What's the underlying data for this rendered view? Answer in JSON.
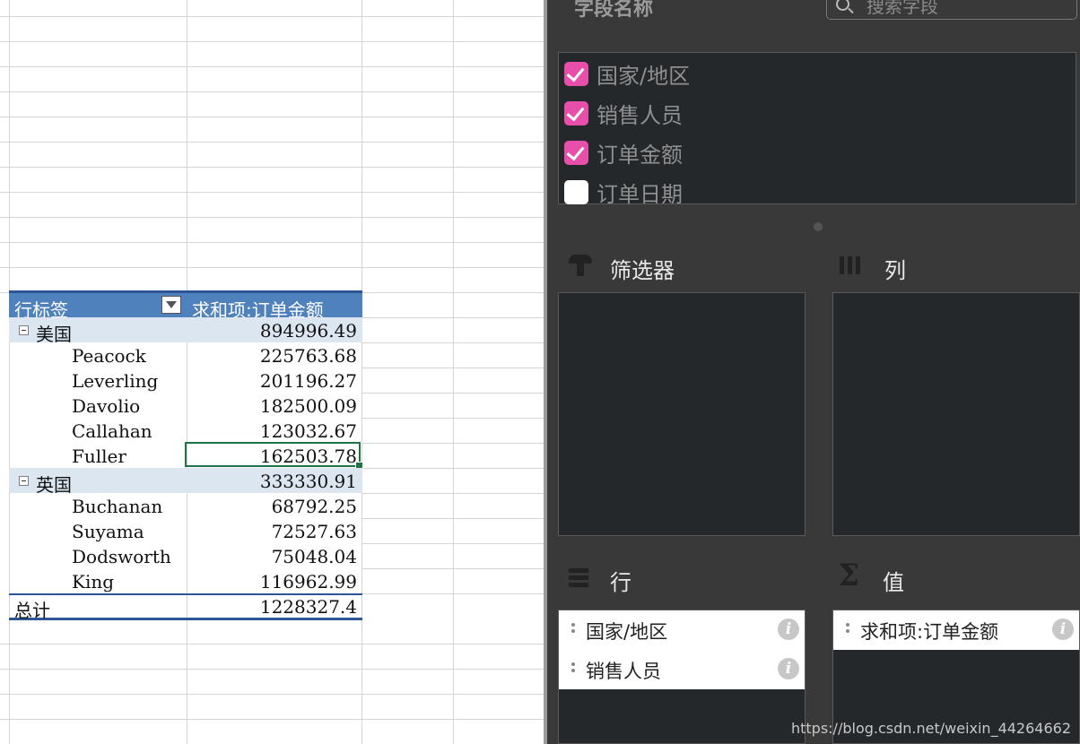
{
  "pivot": {
    "header": {
      "row_label": "行标签",
      "value_label": "求和项:订单金额"
    },
    "groups": [
      {
        "name": "美国",
        "total": "894996.49",
        "people": [
          {
            "name": "Peacock",
            "value": "225763.68"
          },
          {
            "name": "Leverling",
            "value": "201196.27"
          },
          {
            "name": "Davolio",
            "value": "182500.09"
          },
          {
            "name": "Callahan",
            "value": "123032.67"
          },
          {
            "name": "Fuller",
            "value": "162503.78"
          }
        ]
      },
      {
        "name": "英国",
        "total": "333330.91",
        "people": [
          {
            "name": "Buchanan",
            "value": "68792.25"
          },
          {
            "name": "Suyama",
            "value": "72527.63"
          },
          {
            "name": "Dodsworth",
            "value": "75048.04"
          },
          {
            "name": "King",
            "value": "116962.99"
          }
        ]
      }
    ],
    "grand_total": {
      "label": "总计",
      "value": "1228327.4"
    }
  },
  "field_pane": {
    "title": "字段名称",
    "search_placeholder": "搜索字段",
    "fields": [
      {
        "label": "国家/地区",
        "checked": true
      },
      {
        "label": "销售人员",
        "checked": true
      },
      {
        "label": "订单金额",
        "checked": true
      },
      {
        "label": "订单日期",
        "checked": false
      }
    ],
    "zones": {
      "filters": {
        "title": "筛选器",
        "icon": "filter-icon"
      },
      "columns": {
        "title": "列",
        "icon": "columns-icon"
      },
      "rows": {
        "title": "行",
        "icon": "rows-icon",
        "items": [
          "国家/地区",
          "销售人员"
        ]
      },
      "values": {
        "title": "值",
        "icon": "sigma-icon",
        "items": [
          "求和项:订单金额"
        ]
      }
    },
    "info_glyph": "i"
  },
  "colors": {
    "pivot_header": "#4f81bd",
    "group_row": "#dce6f1",
    "checkbox": "#e84faa",
    "selection": "#217346",
    "pane_bg": "#393939"
  },
  "watermark": "https://blog.csdn.net/weixin_44264662"
}
